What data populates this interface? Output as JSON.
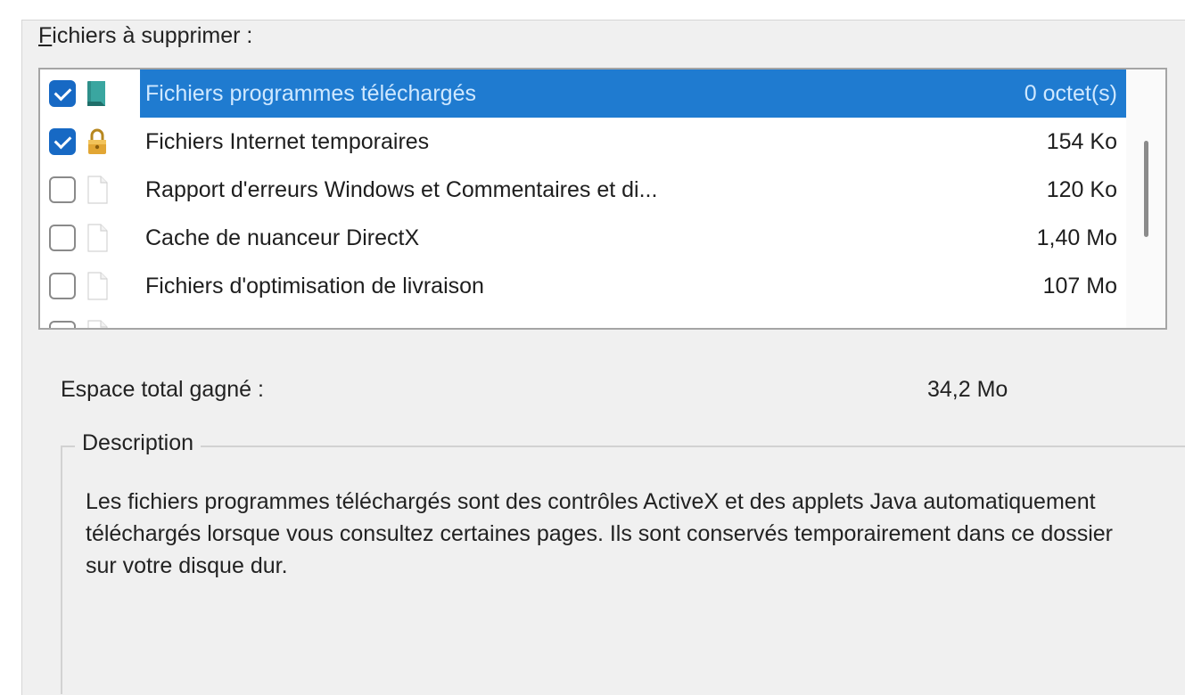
{
  "files_label": {
    "mnemonic": "F",
    "rest": "ichiers à supprimer :"
  },
  "items": [
    {
      "name": "Fichiers programmes téléchargés",
      "size": "0 octet(s)",
      "checked": true,
      "selected": true,
      "icon": "teal-folder-icon"
    },
    {
      "name": "Fichiers Internet temporaires",
      "size": "154 Ko",
      "checked": true,
      "selected": false,
      "icon": "lock-icon"
    },
    {
      "name": "Rapport d'erreurs Windows et Commentaires et di...",
      "size": "120 Ko",
      "checked": false,
      "selected": false,
      "icon": "blank-page-icon"
    },
    {
      "name": "Cache de nuanceur DirectX",
      "size": "1,40 Mo",
      "checked": false,
      "selected": false,
      "icon": "blank-page-icon"
    },
    {
      "name": "Fichiers d'optimisation de livraison",
      "size": "107 Mo",
      "checked": false,
      "selected": false,
      "icon": "blank-page-icon"
    },
    {
      "name": "",
      "size": "",
      "checked": false,
      "selected": false,
      "icon": "blank-page-icon"
    }
  ],
  "total": {
    "label": "Espace total gagné :",
    "value": "34,2 Mo"
  },
  "description": {
    "legend": "Description",
    "text": "Les fichiers programmes téléchargés sont des contrôles ActiveX et des applets Java automatiquement téléchargés lorsque vous consultez certaines pages. Ils sont conservés temporairement dans ce dossier sur votre disque dur."
  },
  "colors": {
    "selection": "#1f7bd0",
    "checkbox_checked": "#1769c4"
  }
}
